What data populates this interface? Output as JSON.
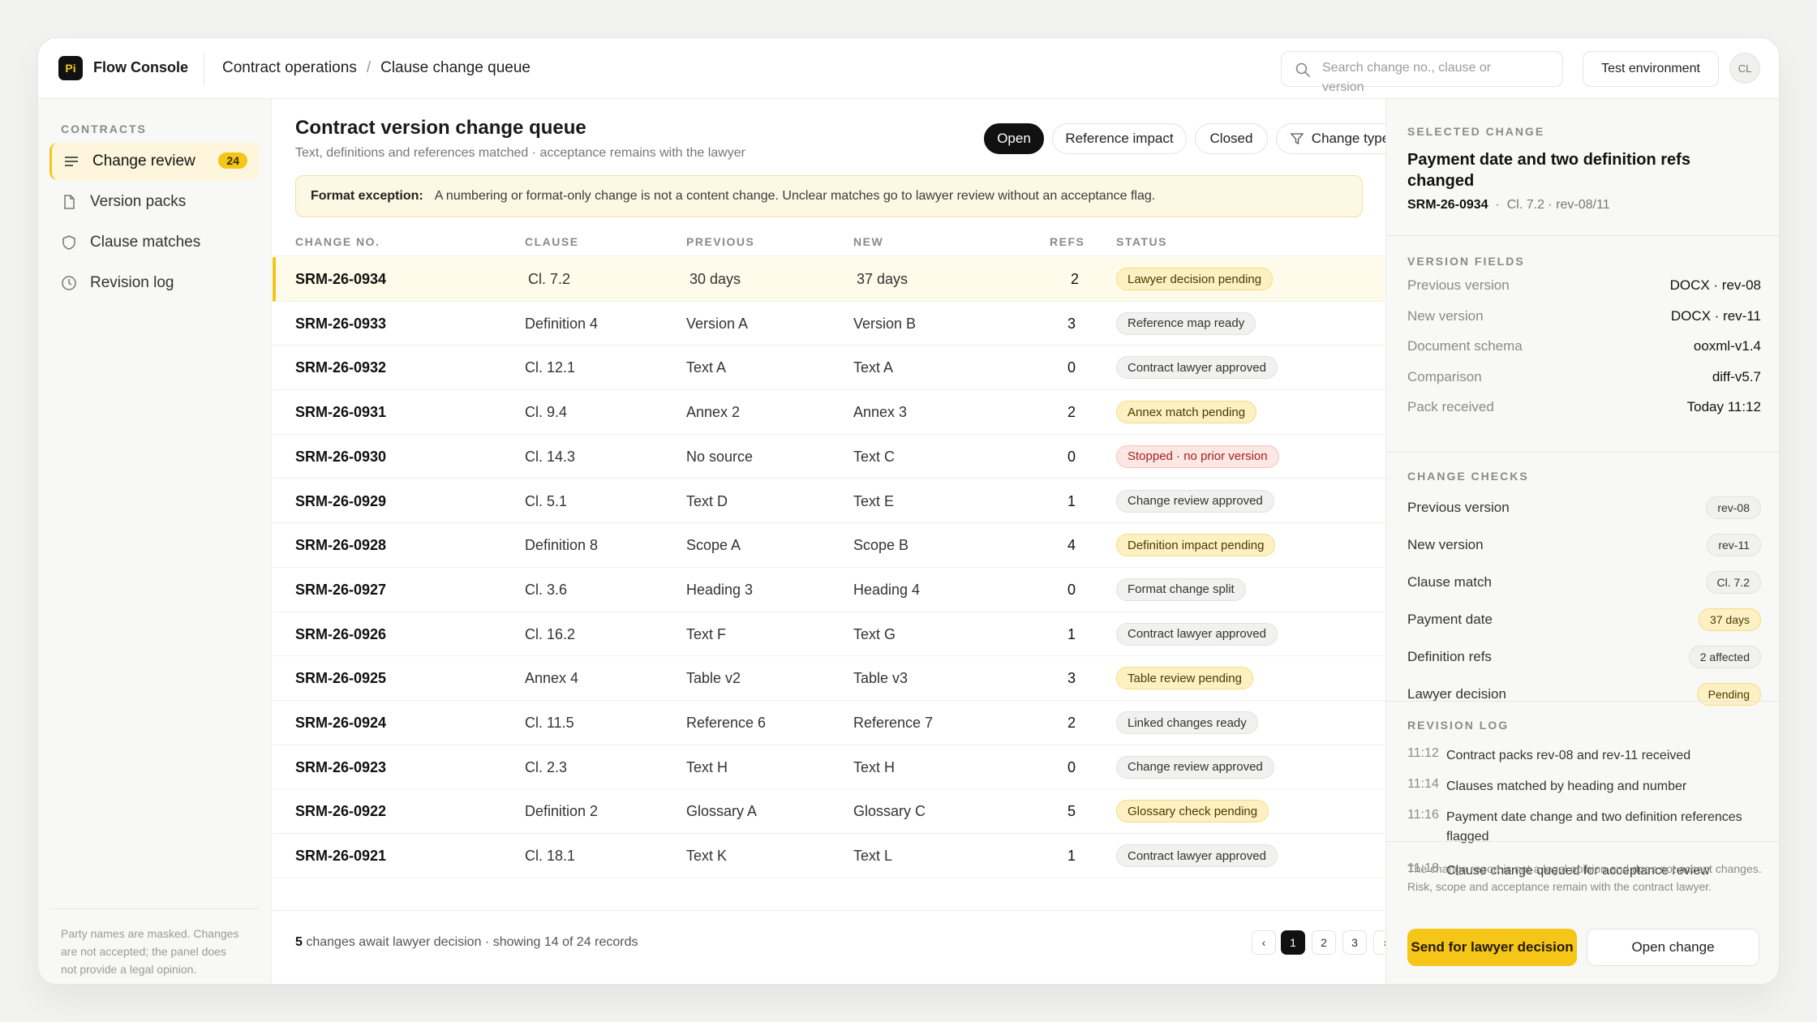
{
  "app": {
    "logo_text": "Pi",
    "name": "Flow Console"
  },
  "breadcrumb": {
    "section": "Contract operations",
    "separator": "/",
    "page": "Clause change queue"
  },
  "search": {
    "placeholder": "Search change no., clause or version"
  },
  "env_button": "Test environment",
  "avatar_initials": "CL",
  "sidebar": {
    "heading": "CONTRACTS",
    "items": [
      {
        "label": "Change review",
        "icon": "list-icon",
        "badge": "24",
        "active": true
      },
      {
        "label": "Version packs",
        "icon": "file-icon"
      },
      {
        "label": "Clause matches",
        "icon": "shield-icon"
      },
      {
        "label": "Revision log",
        "icon": "clock-icon"
      }
    ],
    "footer_note": "Party names are masked. Changes are not accepted; the panel does not provide a legal opinion."
  },
  "main": {
    "title": "Contract version change queue",
    "subtitle": "Text, definitions and references matched · acceptance remains with the lawyer",
    "filters": [
      {
        "label": "Open",
        "active": true
      },
      {
        "label": "Reference impact"
      },
      {
        "label": "Closed"
      },
      {
        "label": "Change type",
        "icon": "filter-icon"
      }
    ],
    "notice": {
      "label": "Format exception:",
      "text": "A numbering or format-only change is not a content change. Unclear matches go to lawyer review without an acceptance flag."
    },
    "columns": [
      "CHANGE NO.",
      "CLAUSE",
      "PREVIOUS",
      "NEW",
      "REFS",
      "STATUS"
    ],
    "rows": [
      {
        "no": "SRM-26-0934",
        "clause": "Cl. 7.2",
        "prev": "30 days",
        "new": "37 days",
        "refs": "2",
        "status": "Lawyer decision pending",
        "tone": "yellow",
        "selected": true
      },
      {
        "no": "SRM-26-0933",
        "clause": "Definition 4",
        "prev": "Version A",
        "new": "Version B",
        "refs": "3",
        "status": "Reference map ready",
        "tone": "gray"
      },
      {
        "no": "SRM-26-0932",
        "clause": "Cl. 12.1",
        "prev": "Text A",
        "new": "Text A",
        "refs": "0",
        "status": "Contract lawyer approved",
        "tone": "gray"
      },
      {
        "no": "SRM-26-0931",
        "clause": "Cl. 9.4",
        "prev": "Annex 2",
        "new": "Annex 3",
        "refs": "2",
        "status": "Annex match pending",
        "tone": "yellow"
      },
      {
        "no": "SRM-26-0930",
        "clause": "Cl. 14.3",
        "prev": "No source",
        "new": "Text C",
        "refs": "0",
        "status": "Stopped · no prior version",
        "tone": "red"
      },
      {
        "no": "SRM-26-0929",
        "clause": "Cl. 5.1",
        "prev": "Text D",
        "new": "Text E",
        "refs": "1",
        "status": "Change review approved",
        "tone": "gray"
      },
      {
        "no": "SRM-26-0928",
        "clause": "Definition 8",
        "prev": "Scope A",
        "new": "Scope B",
        "refs": "4",
        "status": "Definition impact pending",
        "tone": "yellow"
      },
      {
        "no": "SRM-26-0927",
        "clause": "Cl. 3.6",
        "prev": "Heading 3",
        "new": "Heading 4",
        "refs": "0",
        "status": "Format change split",
        "tone": "gray"
      },
      {
        "no": "SRM-26-0926",
        "clause": "Cl. 16.2",
        "prev": "Text F",
        "new": "Text G",
        "refs": "1",
        "status": "Contract lawyer approved",
        "tone": "gray"
      },
      {
        "no": "SRM-26-0925",
        "clause": "Annex 4",
        "prev": "Table v2",
        "new": "Table v3",
        "refs": "3",
        "status": "Table review pending",
        "tone": "yellow"
      },
      {
        "no": "SRM-26-0924",
        "clause": "Cl. 11.5",
        "prev": "Reference 6",
        "new": "Reference 7",
        "refs": "2",
        "status": "Linked changes ready",
        "tone": "gray"
      },
      {
        "no": "SRM-26-0923",
        "clause": "Cl. 2.3",
        "prev": "Text H",
        "new": "Text H",
        "refs": "0",
        "status": "Change review approved",
        "tone": "gray"
      },
      {
        "no": "SRM-26-0922",
        "clause": "Definition 2",
        "prev": "Glossary A",
        "new": "Glossary C",
        "refs": "5",
        "status": "Glossary check pending",
        "tone": "yellow"
      },
      {
        "no": "SRM-26-0921",
        "clause": "Cl. 18.1",
        "prev": "Text K",
        "new": "Text L",
        "refs": "1",
        "status": "Contract lawyer approved",
        "tone": "gray"
      }
    ],
    "footer": {
      "count": "5",
      "text": " changes await lawyer decision · showing 14 of 24 records"
    },
    "pagination": {
      "prev": "‹",
      "pages": [
        "1",
        "2",
        "3"
      ],
      "current": "1",
      "next": "›"
    }
  },
  "panel": {
    "selected_heading": "SELECTED CHANGE",
    "title": "Payment date and two definition refs changed",
    "id": "SRM-26-0934",
    "id_meta": "Cl. 7.2 · rev-08/11",
    "version_heading": "VERSION FIELDS",
    "version_fields": [
      {
        "k": "Previous version",
        "v": "DOCX · rev-08"
      },
      {
        "k": "New version",
        "v": "DOCX · rev-11"
      },
      {
        "k": "Document schema",
        "v": "ooxml-v1.4"
      },
      {
        "k": "Comparison",
        "v": "diff-v5.7"
      },
      {
        "k": "Pack received",
        "v": "Today 11:12"
      }
    ],
    "checks_heading": "CHANGE CHECKS",
    "checks": [
      {
        "k": "Previous version",
        "v": "rev-08",
        "tone": "gray"
      },
      {
        "k": "New version",
        "v": "rev-11",
        "tone": "gray"
      },
      {
        "k": "Clause match",
        "v": "Cl. 7.2",
        "tone": "gray"
      },
      {
        "k": "Payment date",
        "v": "37 days",
        "tone": "yellow"
      },
      {
        "k": "Definition refs",
        "v": "2 affected",
        "tone": "gray"
      },
      {
        "k": "Lawyer decision",
        "v": "Pending",
        "tone": "yellow"
      }
    ],
    "log_heading": "REVISION LOG",
    "log": [
      {
        "t": "11:12",
        "m": "Contract packs rev-08 and rev-11 received"
      },
      {
        "t": "11:14",
        "m": "Clauses matched by heading and number"
      },
      {
        "t": "11:16",
        "m": "Payment date change and two definition references flagged"
      },
      {
        "t": "11:18",
        "m": "Clause change queued for acceptance review"
      }
    ],
    "note": "The change report is not a legal opinion and does not accept changes. Risk, scope and acceptance remain with the contract lawyer.",
    "primary_button": "Send for lawyer decision",
    "secondary_button": "Open change"
  },
  "colors": {
    "accent": "#f5c518",
    "dark": "#111111",
    "pending_bg": "#fdf1c4",
    "stopped_bg": "#fde7e5"
  }
}
